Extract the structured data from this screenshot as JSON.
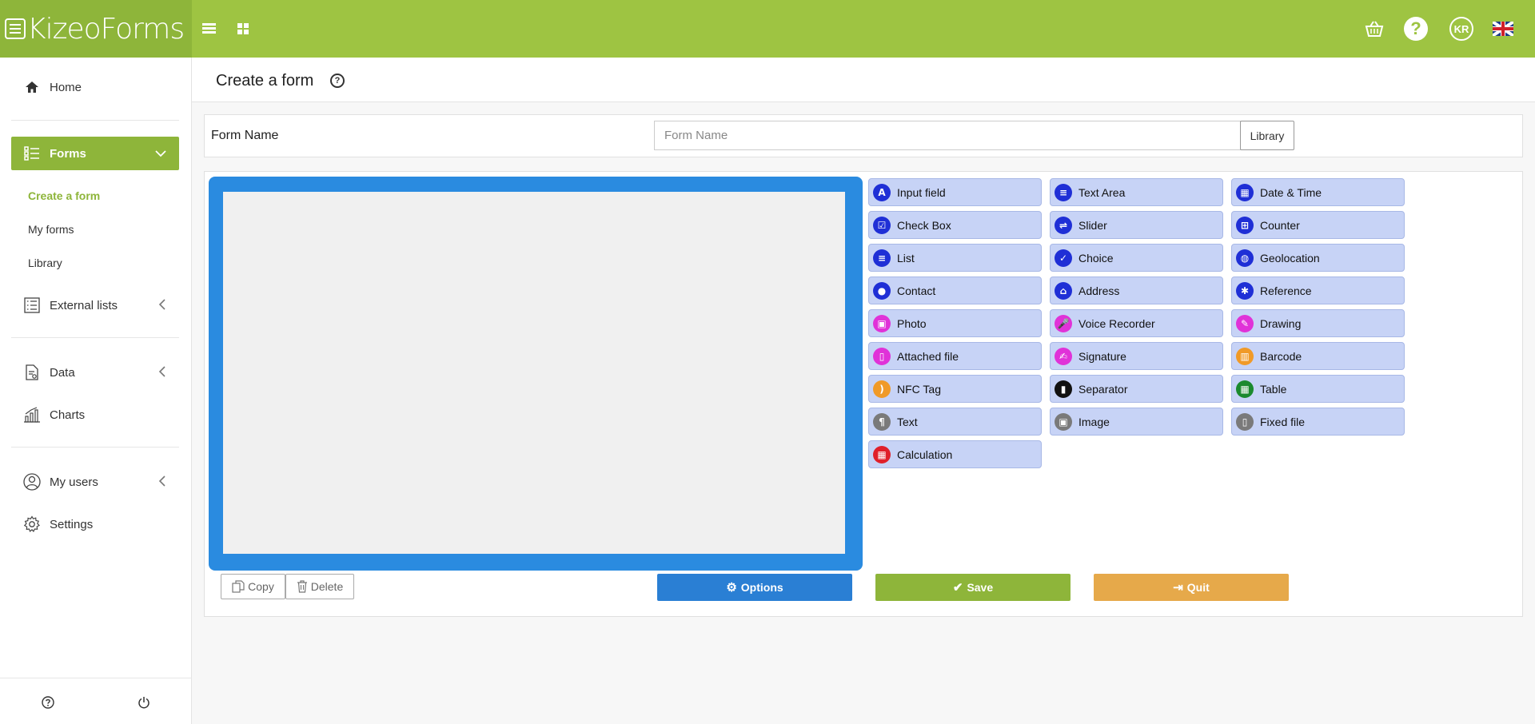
{
  "app": {
    "logo_text": "KizeoForms"
  },
  "topbar": {
    "help_label": "?",
    "avatar_initials": "KR"
  },
  "sidebar": {
    "home": "Home",
    "forms": "Forms",
    "forms_sub": [
      "Create a form",
      "My forms",
      "Library"
    ],
    "external_lists": "External lists",
    "data": "Data",
    "charts": "Charts",
    "my_users": "My users",
    "settings": "Settings"
  },
  "page": {
    "title": "Create a form"
  },
  "form_name": {
    "label": "Form Name",
    "placeholder": "Form Name",
    "library_button": "Library"
  },
  "palette": [
    {
      "label": "Input field",
      "icon": "letter-a-icon",
      "color": "#1f2fd6",
      "glyph": "A"
    },
    {
      "label": "Text Area",
      "icon": "text-lines-icon",
      "color": "#1f2fd6",
      "glyph": "≡"
    },
    {
      "label": "Date & Time",
      "icon": "calendar-icon",
      "color": "#1f2fd6",
      "glyph": "▦"
    },
    {
      "label": "Check Box",
      "icon": "checkbox-icon",
      "color": "#1f2fd6",
      "glyph": "☑"
    },
    {
      "label": "Slider",
      "icon": "slider-icon",
      "color": "#1f2fd6",
      "glyph": "⇌"
    },
    {
      "label": "Counter",
      "icon": "plus-square-icon",
      "color": "#1f2fd6",
      "glyph": "⊞"
    },
    {
      "label": "List",
      "icon": "list-icon",
      "color": "#1f2fd6",
      "glyph": "≡"
    },
    {
      "label": "Choice",
      "icon": "check-circle-icon",
      "color": "#1f2fd6",
      "glyph": "✓"
    },
    {
      "label": "Geolocation",
      "icon": "globe-icon",
      "color": "#1f2fd6",
      "glyph": "◍"
    },
    {
      "label": "Contact",
      "icon": "user-icon",
      "color": "#1f2fd6",
      "glyph": "●"
    },
    {
      "label": "Address",
      "icon": "home-icon",
      "color": "#1f2fd6",
      "glyph": "⌂"
    },
    {
      "label": "Reference",
      "icon": "asterisk-icon",
      "color": "#1f2fd6",
      "glyph": "✱"
    },
    {
      "label": "Photo",
      "icon": "picture-icon",
      "color": "#e032d8",
      "glyph": "▣"
    },
    {
      "label": "Voice Recorder",
      "icon": "microphone-icon",
      "color": "#e032d8",
      "glyph": "🎤"
    },
    {
      "label": "Drawing",
      "icon": "brush-icon",
      "color": "#e032d8",
      "glyph": "✎"
    },
    {
      "label": "Attached file",
      "icon": "file-icon",
      "color": "#e032d8",
      "glyph": "▯"
    },
    {
      "label": "Signature",
      "icon": "signature-icon",
      "color": "#e032d8",
      "glyph": "✍"
    },
    {
      "label": "Barcode",
      "icon": "barcode-icon",
      "color": "#f09a28",
      "glyph": "▥"
    },
    {
      "label": "NFC Tag",
      "icon": "rss-icon",
      "color": "#f09a28",
      "glyph": ")"
    },
    {
      "label": "Separator",
      "icon": "bookmark-icon",
      "color": "#111111",
      "glyph": "▮"
    },
    {
      "label": "Table",
      "icon": "table-icon",
      "color": "#1b8a2e",
      "glyph": "▦"
    },
    {
      "label": "Text",
      "icon": "paragraph-icon",
      "color": "#7a7a7a",
      "glyph": "¶"
    },
    {
      "label": "Image",
      "icon": "image-icon",
      "color": "#7a7a7a",
      "glyph": "▣"
    },
    {
      "label": "Fixed file",
      "icon": "fixed-file-icon",
      "color": "#7a7a7a",
      "glyph": "▯"
    },
    {
      "label": "Calculation",
      "icon": "calculator-icon",
      "color": "#e0202a",
      "glyph": "▦"
    }
  ],
  "actions": {
    "copy": "Copy",
    "delete": "Delete",
    "options": "Options",
    "save": "Save",
    "quit": "Quit"
  },
  "colors": {
    "brand": "#9ec442",
    "options": "#2a7fd4",
    "save": "#8eb53a",
    "quit": "#e6a94a",
    "canvas_border": "#2a8be0"
  }
}
